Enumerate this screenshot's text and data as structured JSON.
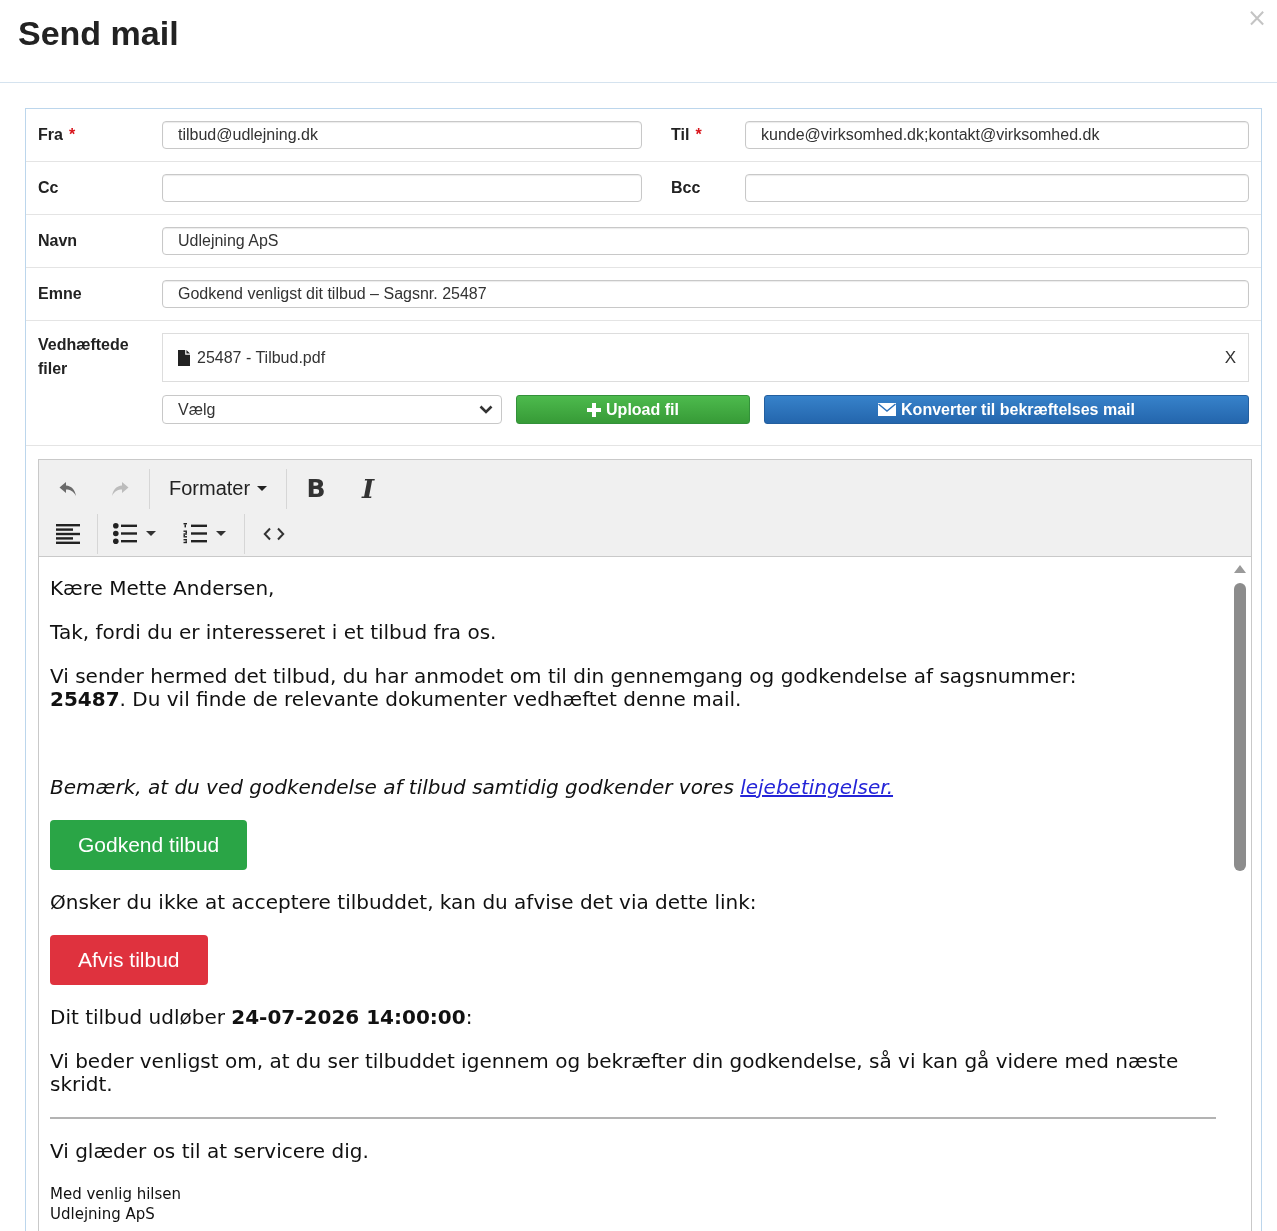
{
  "dialog": {
    "title": "Send mail",
    "close": "×"
  },
  "form": {
    "required_mark": "*",
    "rows": [
      {
        "fields": [
          {
            "label": "Fra",
            "required": true,
            "value": "tilbud@udlejning.dk"
          },
          {
            "label": "Til",
            "required": true,
            "value": "kunde@virksomhed.dk;kontakt@virksomhed.dk"
          }
        ]
      },
      {
        "fields": [
          {
            "label": "Cc",
            "required": false
          },
          {
            "label": "Bcc",
            "required": false
          }
        ]
      },
      {
        "fields": [
          {
            "label": "Navn",
            "required": false,
            "value": "Udlejning ApS"
          }
        ]
      },
      {
        "fields": [
          {
            "label": "Emne",
            "required": false,
            "value": "Godkend venligst dit tilbud – Sagsnr. 25487"
          }
        ]
      }
    ],
    "attachments": {
      "label": "Vedhæftede filer",
      "files": [
        {
          "name": "25487 - Tilbud.pdf",
          "remove": "X"
        }
      ],
      "select": {
        "value": "Vælg"
      },
      "buttons": [
        {
          "kind": "upload",
          "label": "Upload fil"
        },
        {
          "kind": "convert",
          "label": "Konverter til bekræftelses mail"
        }
      ]
    }
  },
  "editor": {
    "toolbar": [
      [
        [
          {
            "kind": "undo",
            "disabled": false
          },
          {
            "kind": "redo",
            "disabled": true
          }
        ],
        [
          {
            "kind": "format_menu",
            "label": "Formater"
          }
        ],
        [
          {
            "kind": "bold",
            "label": "B"
          },
          {
            "kind": "italic",
            "label": "I"
          }
        ]
      ],
      [
        [
          {
            "kind": "align_left"
          }
        ],
        [
          {
            "kind": "bullet_list"
          },
          {
            "kind": "numbered_list"
          }
        ],
        [
          {
            "kind": "source_code"
          }
        ]
      ]
    ],
    "body": [
      {
        "kind": "text",
        "text": "Kære Mette Andersen,"
      },
      {
        "kind": "text",
        "text": "Tak, fordi du er interesseret i et tilbud fra os."
      },
      {
        "kind": "text",
        "lines": [
          "Vi sender hermed det tilbud, du har anmodet om til din gennemgang og godkendelse af sagsnummer:",
          "**25487**.  Du vil finde de relevante dokumenter vedhæftet denne mail."
        ]
      },
      {
        "kind": "note",
        "text": "Bemærk, at du ved godkendelse af tilbud samtidig godkender vores",
        "link": "lejebetingelser."
      },
      {
        "kind": "accept",
        "label": "Godkend tilbud"
      },
      {
        "kind": "text",
        "text": "Ønsker du ikke at acceptere tilbuddet, kan du afvise det via dette link:"
      },
      {
        "kind": "reject",
        "label": "Afvis tilbud"
      },
      {
        "kind": "text",
        "text": "Dit tilbud udløber **24-07-2026 14:00:00**:"
      },
      {
        "kind": "text",
        "text": "Vi beder venligst om, at du ser tilbuddet igennem og bekræfter din godkendelse, så vi kan gå videre med næste skridt."
      },
      {
        "kind": "rule"
      },
      {
        "kind": "text",
        "text": "Vi glæder os til at servicere dig."
      },
      {
        "kind": "signature",
        "lines": [
          "Med venlig hilsen",
          "Udlejning ApS"
        ]
      }
    ]
  }
}
